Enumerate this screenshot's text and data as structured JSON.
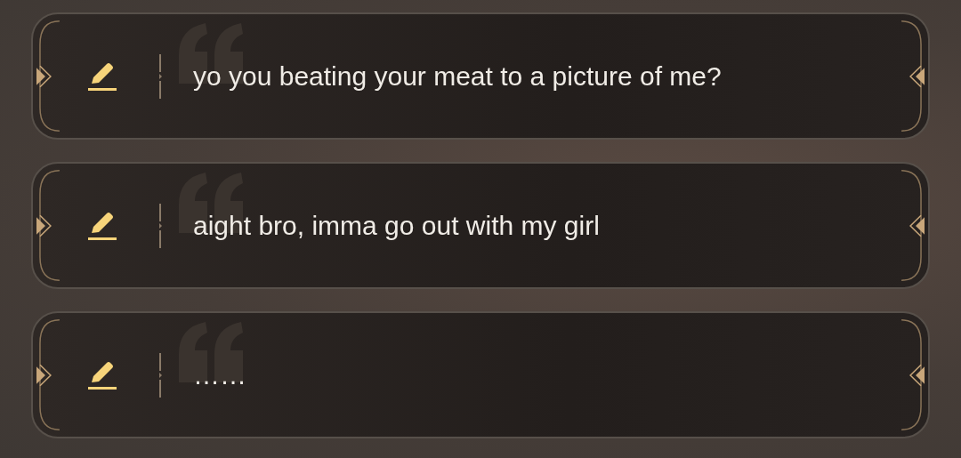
{
  "options": [
    {
      "text": "yo you beating your meat to a picture of me?"
    },
    {
      "text": "aight bro, imma go out with my girl"
    },
    {
      "text": "……"
    }
  ]
}
